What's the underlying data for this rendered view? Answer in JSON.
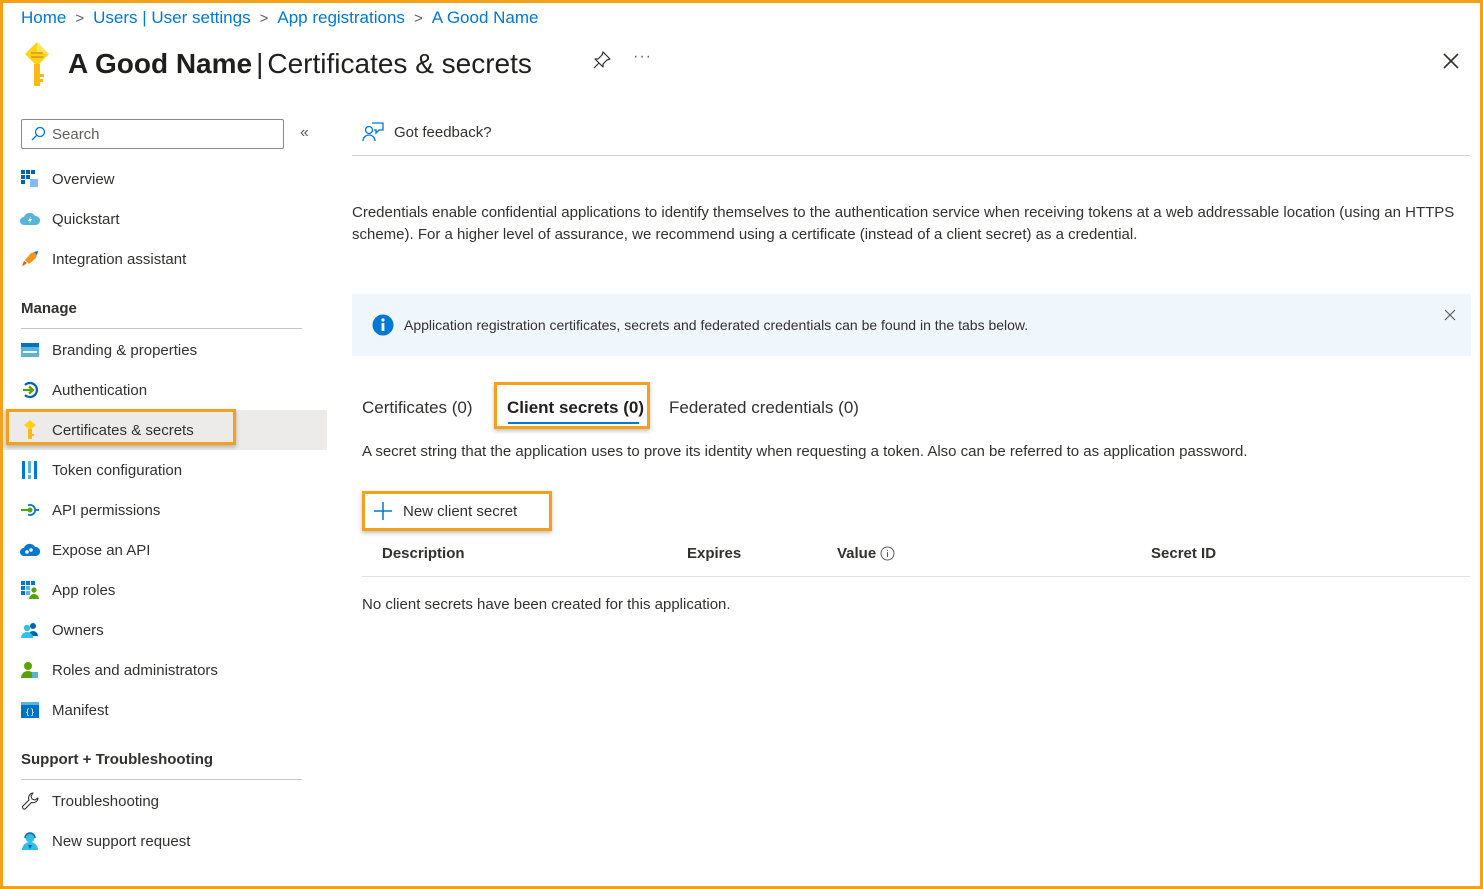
{
  "breadcrumb": [
    "Home",
    "Users | User settings",
    "App registrations",
    "A Good Name"
  ],
  "header": {
    "app_name": "A Good Name",
    "separator": "|",
    "page_name": "Certificates & secrets",
    "more_label": "···"
  },
  "sidebar": {
    "search_placeholder": "Search",
    "collapse_label": "«",
    "top_items": [
      {
        "label": "Overview",
        "icon": "overview-icon"
      },
      {
        "label": "Quickstart",
        "icon": "quickstart-icon"
      },
      {
        "label": "Integration assistant",
        "icon": "rocket-icon"
      }
    ],
    "manage_heading": "Manage",
    "manage_items": [
      {
        "label": "Branding & properties",
        "icon": "branding-icon"
      },
      {
        "label": "Authentication",
        "icon": "authentication-icon"
      },
      {
        "label": "Certificates & secrets",
        "icon": "key-icon",
        "active": true
      },
      {
        "label": "Token configuration",
        "icon": "token-icon"
      },
      {
        "label": "API permissions",
        "icon": "api-permissions-icon"
      },
      {
        "label": "Expose an API",
        "icon": "cloud-api-icon"
      },
      {
        "label": "App roles",
        "icon": "app-roles-icon"
      },
      {
        "label": "Owners",
        "icon": "owners-icon"
      },
      {
        "label": "Roles and administrators",
        "icon": "roles-admin-icon"
      },
      {
        "label": "Manifest",
        "icon": "manifest-icon"
      }
    ],
    "support_heading": "Support + Troubleshooting",
    "support_items": [
      {
        "label": "Troubleshooting",
        "icon": "wrench-icon"
      },
      {
        "label": "New support request",
        "icon": "support-person-icon"
      }
    ]
  },
  "main": {
    "feedback_label": "Got feedback?",
    "description": "Credentials enable confidential applications to identify themselves to the authentication service when receiving tokens at a web addressable location (using an HTTPS scheme). For a higher level of assurance, we recommend using a certificate (instead of a client secret) as a credential.",
    "info_banner": "Application registration certificates, secrets and federated credentials can be found in the tabs below.",
    "tabs": [
      {
        "label": "Certificates (0)",
        "active": false
      },
      {
        "label": "Client secrets (0)",
        "active": true
      },
      {
        "label": "Federated credentials (0)",
        "active": false
      }
    ],
    "tab_description": "A secret string that the application uses to prove its identity when requesting a token. Also can be referred to as application password.",
    "new_secret_label": "New client secret",
    "table": {
      "columns": [
        "Description",
        "Expires",
        "Value",
        "Secret ID"
      ],
      "empty_message": "No client secrets have been created for this application."
    }
  },
  "colors": {
    "accent": "#0078d4",
    "highlight": "#f3a01b",
    "banner_bg": "#eff6fc",
    "active_bg": "#edebe9"
  }
}
